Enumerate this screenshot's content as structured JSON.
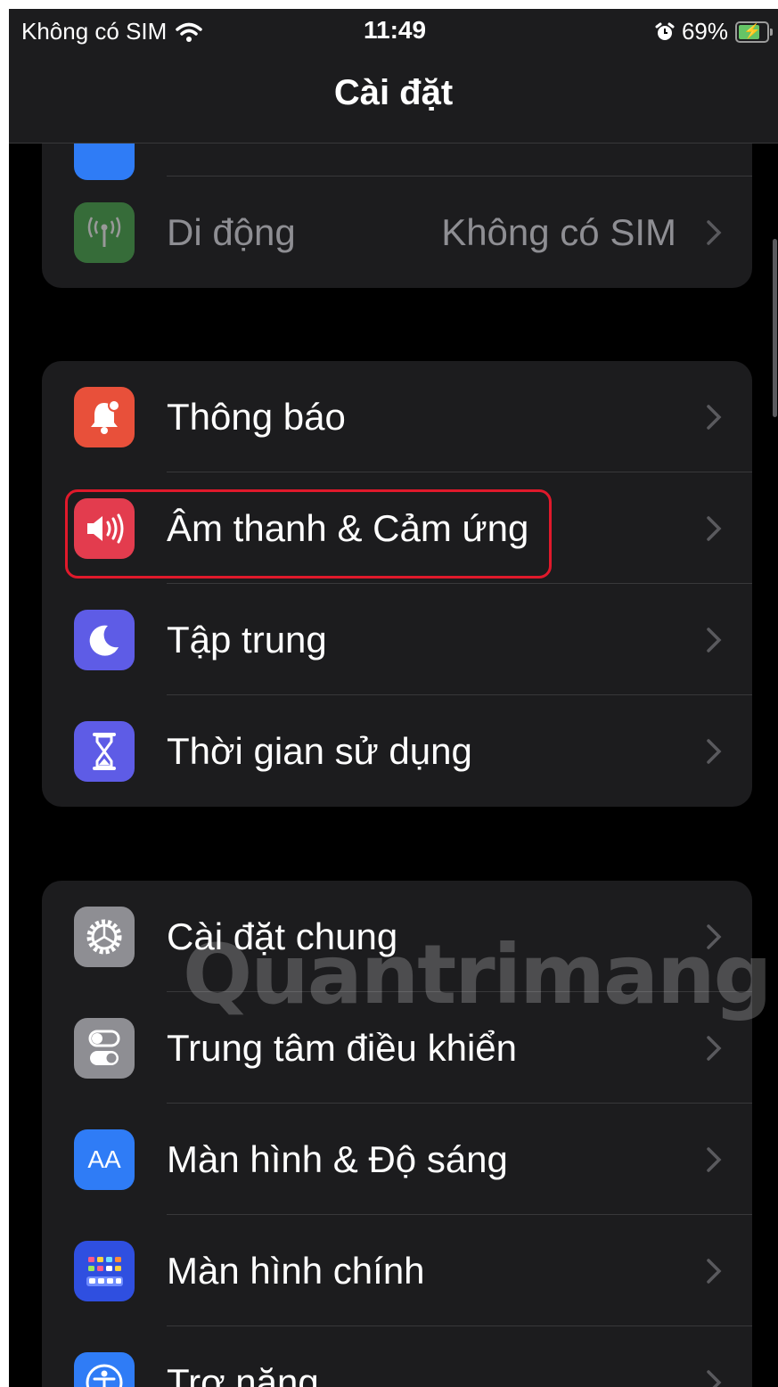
{
  "status_bar": {
    "carrier": "Không có SIM",
    "time": "11:49",
    "battery_percent": "69%",
    "battery_level": 0.69
  },
  "nav": {
    "title": "Cài đặt"
  },
  "groups": [
    {
      "items": [
        {
          "label": "Di động",
          "value": "Không có SIM",
          "icon": "antenna-icon",
          "color": "#4caf50"
        }
      ]
    },
    {
      "items": [
        {
          "label": "Thông báo",
          "icon": "bell-icon",
          "color": "#e8503a"
        },
        {
          "label": "Âm thanh & Cảm ứng",
          "icon": "speaker-icon",
          "color": "#e33c4e"
        },
        {
          "label": "Tập trung",
          "icon": "moon-icon",
          "color": "#5e5ce6"
        },
        {
          "label": "Thời gian sử dụng",
          "icon": "hourglass-icon",
          "color": "#5e5ce6"
        }
      ]
    },
    {
      "items": [
        {
          "label": "Cài đặt chung",
          "icon": "gear-icon",
          "color": "#8e8e93"
        },
        {
          "label": "Trung tâm điều khiển",
          "icon": "toggles-icon",
          "color": "#8e8e93"
        },
        {
          "label": "Màn hình & Độ sáng",
          "icon": "text-size-icon",
          "icon_text": "AA",
          "color": "#2f7cf6"
        },
        {
          "label": "Màn hình chính",
          "icon": "home-grid-icon",
          "color": "#2f4fe0"
        },
        {
          "label": "Trợ năng",
          "icon": "accessibility-icon",
          "color": "#2f7cf6"
        }
      ]
    }
  ],
  "watermark": "Quantrimang"
}
